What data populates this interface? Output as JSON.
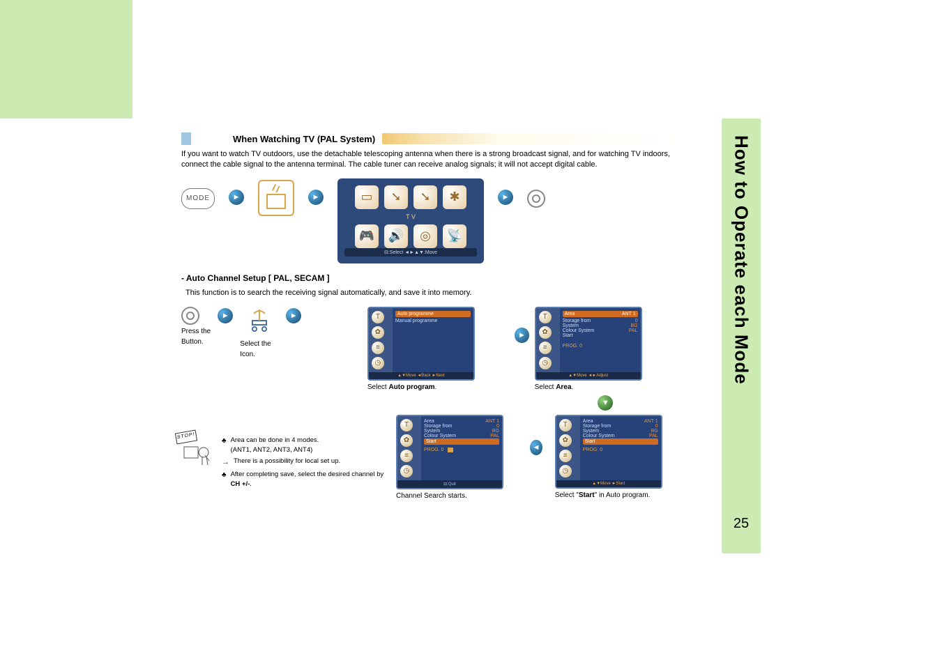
{
  "sidebar_title": "How to Operate each Mode",
  "page_number": "25",
  "section_heading": "When Watching TV (PAL System)",
  "intro": "If you want to watch TV outdoors, use the detachable telescoping antenna when there is a strong broadcast signal, and for watching TV indoors, connect the cable signal to the antenna terminal.  The cable tuner can receive analog signals; it will not accept digital cable.",
  "mode_label": "MODE",
  "menu_label": "T V",
  "menu_footer": "⊟:Select  ◄►▲▼:Move",
  "sub_heading": "- Auto Channel Setup [ PAL, SECAM ]",
  "sub_desc": "This function is to search the receiving signal automatically, and save it into memory.",
  "press_label_l1": "Press the",
  "press_label_l2": "Button.",
  "select_label_l1": "Select the",
  "select_label_l2": "Icon.",
  "osd1": {
    "hl": "Auto programme",
    "line": "Manual programme",
    "footer": "▲▼Move  ◄Back  ►Next",
    "caption_pre": "Select ",
    "caption_bold": "Auto program",
    "caption_suf": "."
  },
  "osd2": {
    "hl": "Area",
    "hl_val": "ANT 1",
    "l1": "Storage from",
    "l1v": "0",
    "l2": "System",
    "l2v": "BG",
    "l3": "Colour System",
    "l3v": "PAL",
    "l4": "Start",
    "prog": "PROG.   0",
    "footer": "▲▼Move  ◄►Adjust",
    "caption_pre": "Select ",
    "caption_bold": "Area",
    "caption_suf": "."
  },
  "osd3": {
    "hl_l": "Start",
    "l0": "Area",
    "l0v": "ANT 1",
    "l1": "Storage from",
    "l1v": "0",
    "l2": "System",
    "l2v": "BG",
    "l3": "Colour System",
    "l3v": "PAL",
    "prog": "PROG.   0",
    "footer": "▲▼Move  ►Start",
    "caption_pre": "Select \"",
    "caption_bold": "Start",
    "caption_suf": "\" in Auto program."
  },
  "osd4": {
    "l0": "Area",
    "l0v": "ANT 1",
    "l1": "Storage from",
    "l1v": "0",
    "l2": "System",
    "l2v": "BG",
    "l3": "Colour System",
    "l3v": "PAL",
    "hl_l": "Start",
    "prog": "PROG.   0",
    "progbar": "▮",
    "footer": "⊟:Quit",
    "caption": "Channel Search starts."
  },
  "stop_label": "STOP!",
  "note1_l1": "Area can be done in 4 modes.",
  "note1_l2": "(ANT1, ANT2, ANT3, ANT4)",
  "note2": "There is a possibility for local set up.",
  "note3_pre": "After completing save, select the desired channel by ",
  "note3_bold": "CH +/-",
  "note3_suf": "."
}
